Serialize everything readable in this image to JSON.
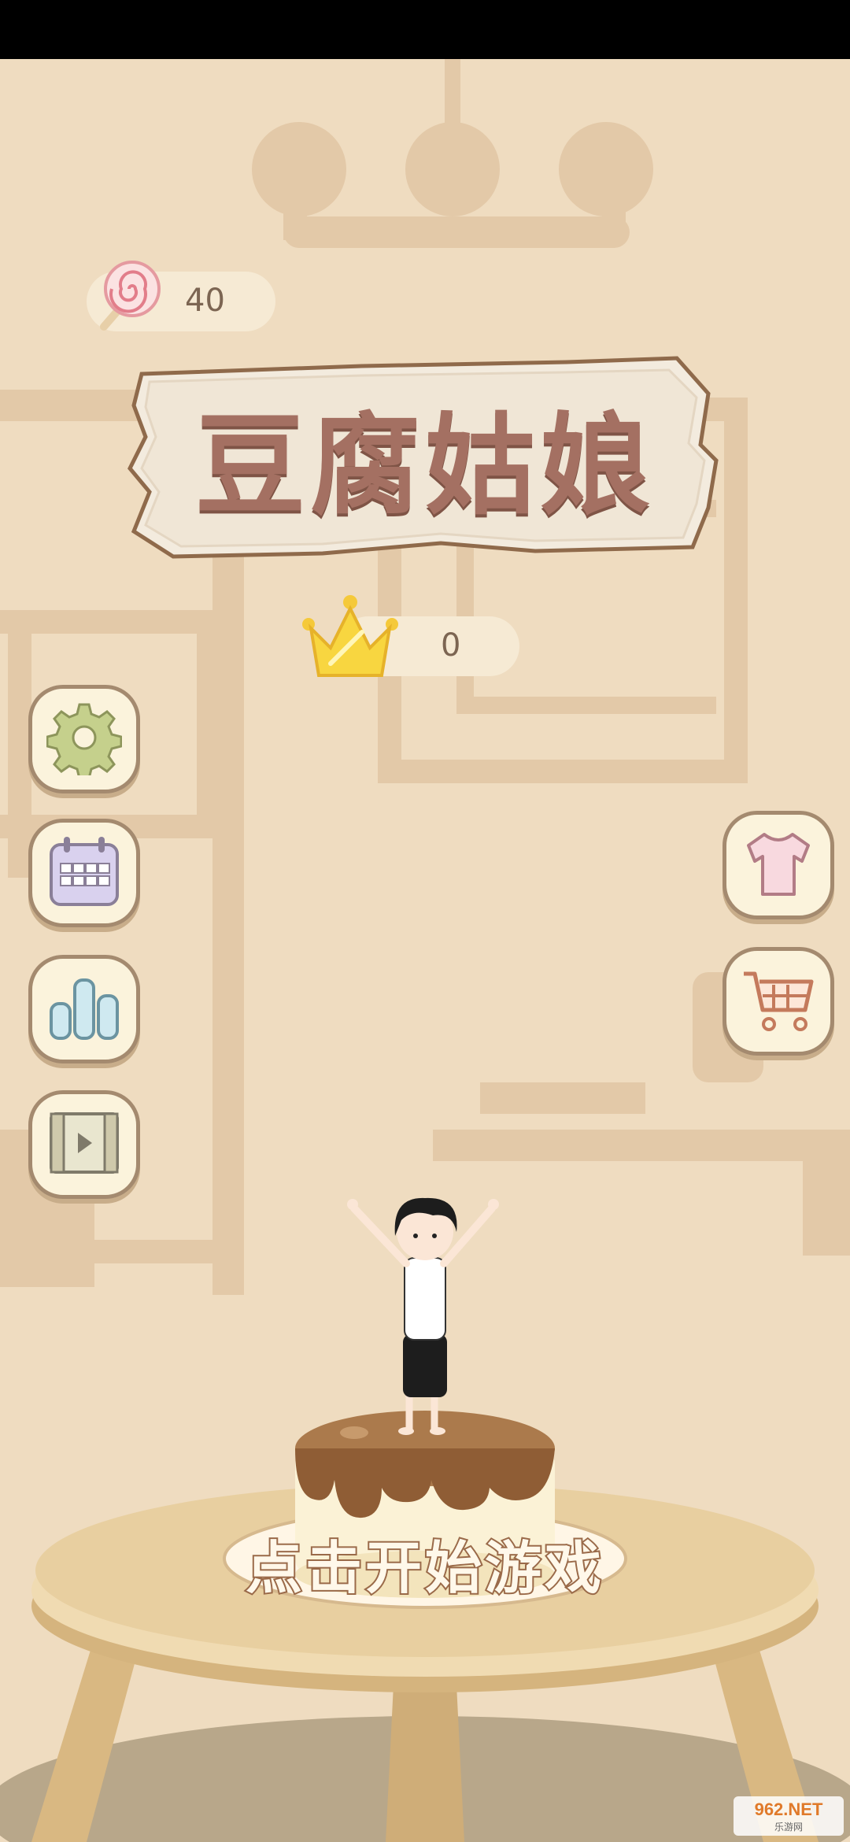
{
  "currency": {
    "icon": "lollipop-icon",
    "value": "40"
  },
  "title": {
    "text": "豆腐姑娘"
  },
  "crown": {
    "icon": "crown-icon",
    "value": "0"
  },
  "left_buttons": [
    {
      "name": "settings-button",
      "icon": "gear-icon"
    },
    {
      "name": "calendar-button",
      "icon": "calendar-icon"
    },
    {
      "name": "leaderboard-button",
      "icon": "bar-chart-icon"
    },
    {
      "name": "video-button",
      "icon": "video-play-icon"
    }
  ],
  "right_buttons": [
    {
      "name": "wardrobe-button",
      "icon": "shirt-icon"
    },
    {
      "name": "shop-button",
      "icon": "shopping-cart-icon"
    }
  ],
  "start_prompt": "点击开始游戏",
  "watermark": {
    "brand": "962.NET",
    "sub": "乐游网"
  },
  "colors": {
    "background": "#efdcc0",
    "silhouette": "#e3c9a8",
    "button_border": "#a48a6f",
    "title_text": "#a47062",
    "table": "#d9b882"
  }
}
